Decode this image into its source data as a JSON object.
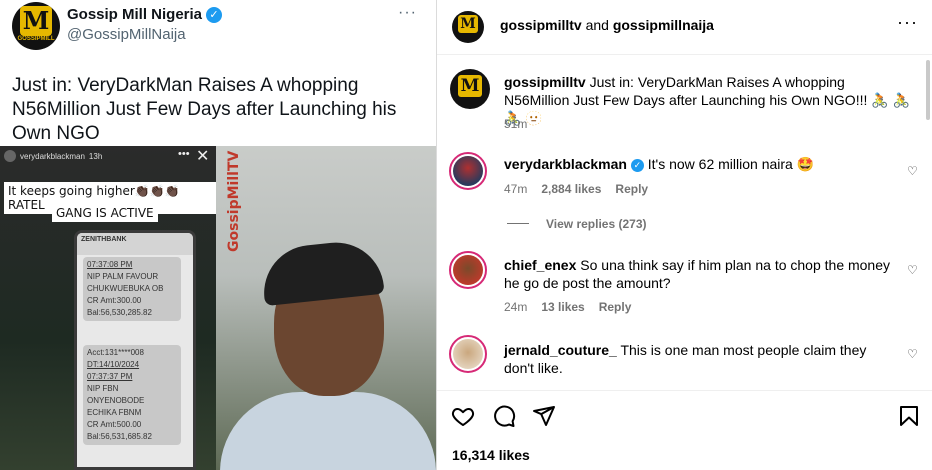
{
  "tweet": {
    "avatar_letter": "M",
    "avatar_subtext": "GOSSIPMILL",
    "name": "Gossip Mill Nigeria",
    "verified_icon": "✓",
    "handle": "@GossipMillNaija",
    "more_icon": "···",
    "text": "Just in: VeryDarkMan Raises A whopping N56Million Just Few Days after Launching his Own NGO",
    "media": {
      "story_user": "verydarkblackman",
      "story_time": "13h",
      "caption_line1": "It keeps going higher👏🏿👏🏿👏🏿 RATEL",
      "caption_line2": "GANG IS ACTIVE",
      "watermark": "GossipMillTV",
      "bank_name": "ZENITHBANK",
      "sms1": [
        "07:37:08 PM",
        "NIP PALM FAVOUR",
        "CHUKWUEBUKA OB",
        "CR Amt:300.00",
        "Bal:56,530,285.82"
      ],
      "sms2": [
        "Acct:131****008",
        "DT:14/10/2024",
        "07:37:37 PM",
        "NIP FBN",
        "ONYENOBODE",
        "ECHIKA FBNM",
        "CR Amt:500.00",
        "Bal:56,531,685.82"
      ]
    }
  },
  "instagram": {
    "header": {
      "user1": "gossipmilltv",
      "joiner": "and",
      "user2": "gossipmillnaija",
      "more_icon": "···"
    },
    "caption": {
      "user": "gossipmilltv",
      "text": "Just in: VeryDarkMan Raises A whopping N56Million Just Few Days after Launching his Own NGO!!! 🚴 🚴 🚴 🫥",
      "time": "51m"
    },
    "comments": [
      {
        "user": "verydarkblackman",
        "verified": true,
        "text": "It's now 62 million naira 🤩",
        "time": "47m",
        "likes": "2,884 likes",
        "reply": "Reply"
      },
      {
        "user": "chief_enex",
        "text": "So una think say if him plan na to chop the money he go de post the amount?",
        "time": "24m",
        "likes": "13 likes",
        "reply": "Reply"
      },
      {
        "user": "jernald_couture_",
        "text": "This is one man most people claim they don't like."
      }
    ],
    "view_replies": "View replies (273)",
    "likes": "16,314 likes",
    "heart_sm_icon": "♡",
    "colors": {
      "verified": "#1d9bf0",
      "muted": "#737373",
      "accent_gold": "#e6b800"
    }
  }
}
